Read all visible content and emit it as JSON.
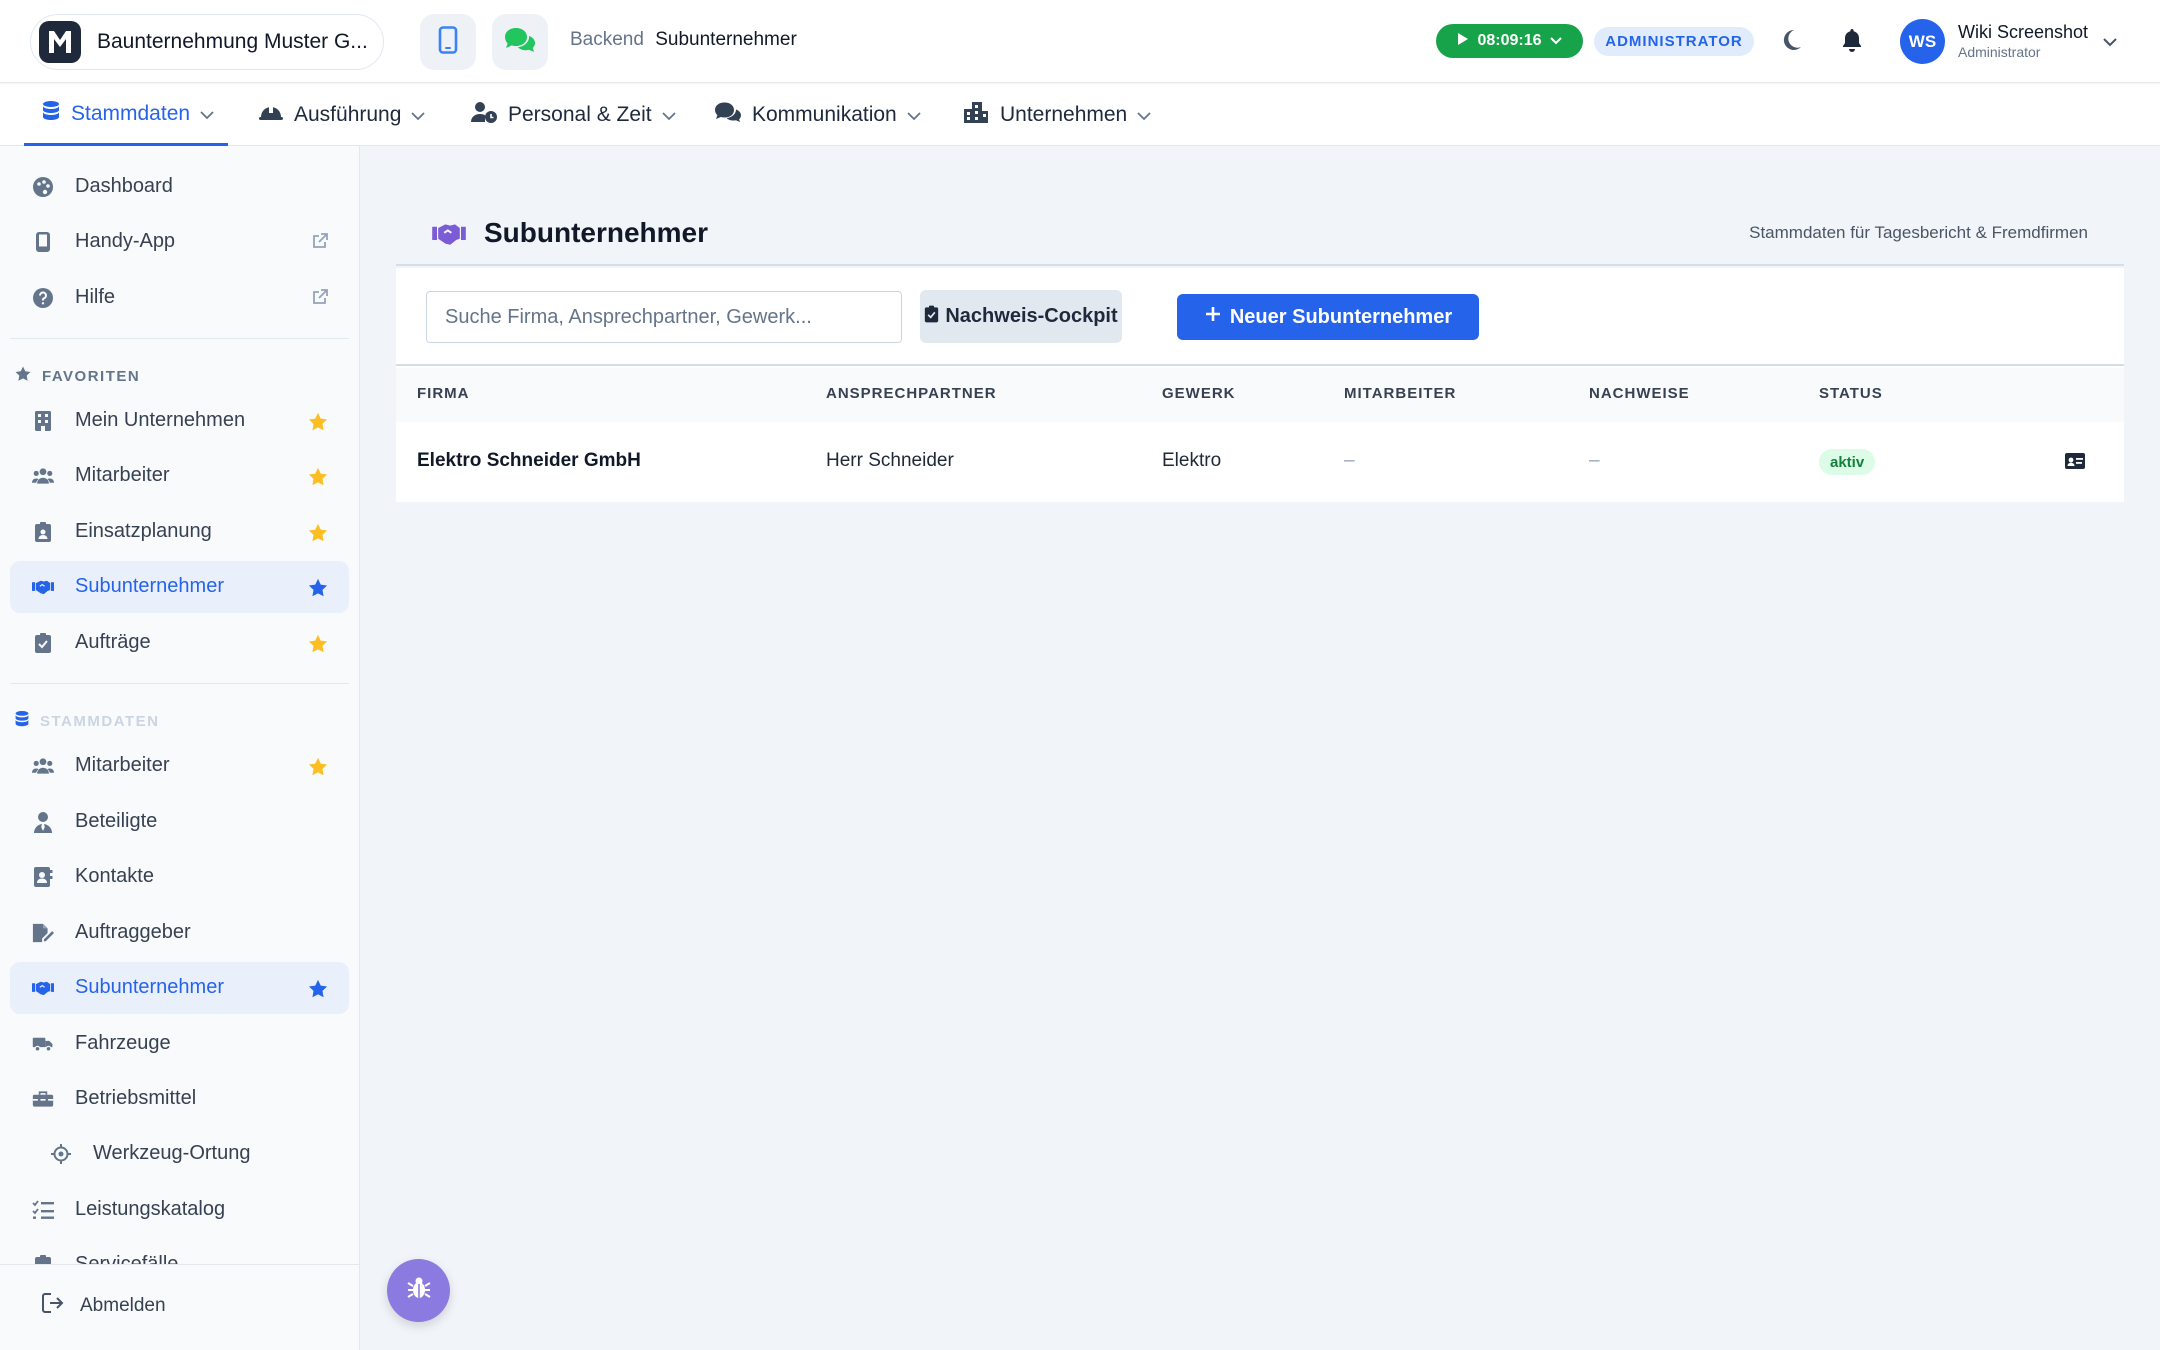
{
  "header": {
    "company_name": "Baunternehmung Muster G...",
    "logo_letter": "M",
    "breadcrumb": {
      "section": "Backend",
      "current": "Subunternehmer"
    },
    "timer": "08:09:16",
    "role_badge": "ADMINISTRATOR",
    "user": {
      "initials": "WS",
      "name": "Wiki Screenshot",
      "role": "Administrator"
    },
    "colors": {
      "timer": "#16a34a",
      "accent": "#2563eb"
    }
  },
  "main_nav": [
    {
      "label": "Stammdaten",
      "icon": "database-icon",
      "active": true
    },
    {
      "label": "Ausführung",
      "icon": "helmet-icon"
    },
    {
      "label": "Personal & Zeit",
      "icon": "user-clock-icon"
    },
    {
      "label": "Kommunikation",
      "icon": "comments-icon"
    },
    {
      "label": "Unternehmen",
      "icon": "city-icon"
    }
  ],
  "sidebar": {
    "top_items": [
      {
        "label": "Dashboard",
        "icon": "palette-icon"
      },
      {
        "label": "Handy-App",
        "icon": "mobile-icon",
        "external": true
      },
      {
        "label": "Hilfe",
        "icon": "question-icon",
        "external": true
      }
    ],
    "favorites_heading": "FAVORITEN",
    "favorites": [
      {
        "label": "Mein Unternehmen",
        "icon": "building-icon",
        "starred": true
      },
      {
        "label": "Mitarbeiter",
        "icon": "users-icon",
        "starred": true
      },
      {
        "label": "Einsatzplanung",
        "icon": "badge-icon",
        "starred": true
      },
      {
        "label": "Subunternehmer",
        "icon": "handshake-icon",
        "starred": true,
        "active": true
      },
      {
        "label": "Aufträge",
        "icon": "clipboard-check-icon",
        "starred": true
      }
    ],
    "stammdaten_heading": "STAMMDATEN",
    "stammdaten": [
      {
        "label": "Mitarbeiter",
        "icon": "users-icon",
        "starred": true
      },
      {
        "label": "Beteiligte",
        "icon": "user-tie-icon"
      },
      {
        "label": "Kontakte",
        "icon": "address-book-icon"
      },
      {
        "label": "Auftraggeber",
        "icon": "file-signature-icon"
      },
      {
        "label": "Subunternehmer",
        "icon": "handshake-icon",
        "starred": true,
        "active": true
      },
      {
        "label": "Fahrzeuge",
        "icon": "truck-icon"
      },
      {
        "label": "Betriebsmittel",
        "icon": "toolbox-icon"
      },
      {
        "label": "Werkzeug-Ortung",
        "icon": "crosshairs-icon",
        "sub": true
      },
      {
        "label": "Leistungskatalog",
        "icon": "list-check-icon"
      },
      {
        "label": "Servicefälle",
        "icon": "service-icon"
      }
    ],
    "logout": "Abmelden"
  },
  "page": {
    "title": "Subunternehmer",
    "subtitle": "Stammdaten für Tagesbericht & Fremdfirmen",
    "search_placeholder": "Suche Firma, Ansprechpartner, Gewerk...",
    "cockpit_button": "Nachweis-Cockpit",
    "new_button": "Neuer Subunternehmer"
  },
  "table": {
    "columns": [
      "FIRMA",
      "ANSPRECHPARTNER",
      "GEWERK",
      "MITARBEITER",
      "NACHWEISE",
      "STATUS"
    ],
    "rows": [
      {
        "firma": "Elektro Schneider GmbH",
        "ansprechpartner": "Herr Schneider",
        "gewerk": "Elektro",
        "mitarbeiter": "–",
        "nachweise": "–",
        "status": "aktiv"
      }
    ]
  }
}
